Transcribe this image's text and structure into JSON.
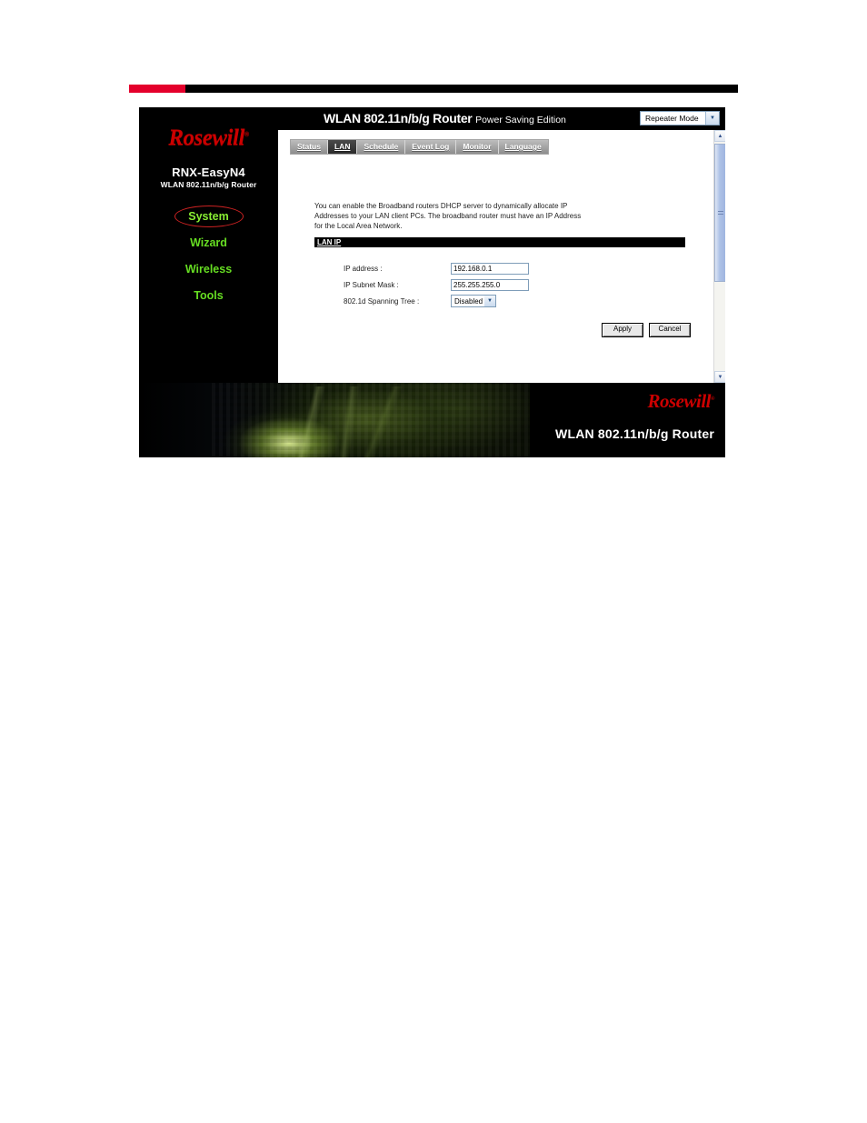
{
  "document": {
    "background": "#ffffff",
    "rule_colors": {
      "red": "#e4002b",
      "black": "#000000"
    }
  },
  "router_ui": {
    "sidebar": {
      "brand_logo": "Rosewill",
      "brand_reg_mark": "®",
      "model_name": "RNX-EasyN4",
      "model_subtitle": "WLAN 802.11n/b/g Router",
      "nav_items": [
        {
          "label": "System",
          "active": true
        },
        {
          "label": "Wizard",
          "active": false
        },
        {
          "label": "Wireless",
          "active": false
        },
        {
          "label": "Tools",
          "active": false
        }
      ],
      "active_color": "#88ee33",
      "nav_color": "#66dd22",
      "highlight_ring_color": "#cc2222"
    },
    "banner": {
      "title_main": "WLAN 802.11n/b/g Router",
      "title_sub": "Power Saving Edition",
      "mode_select": {
        "value": "Repeater Mode",
        "arrow_icon": "▼"
      }
    },
    "tabs": [
      {
        "label": "Status",
        "active": false
      },
      {
        "label": "LAN",
        "active": true
      },
      {
        "label": "Schedule",
        "active": false
      },
      {
        "label": "Event Log",
        "active": false
      },
      {
        "label": "Monitor",
        "active": false
      },
      {
        "label": "Language",
        "active": false
      }
    ],
    "content": {
      "description": "You can enable the Broadband routers DHCP server to dynamically allocate IP Addresses to your LAN client PCs. The broadband router must have an IP Address for the Local Area Network.",
      "section_title": "LAN IP",
      "fields": [
        {
          "label": "IP address :",
          "value": "192.168.0.1",
          "type": "text"
        },
        {
          "label": "IP Subnet Mask :",
          "value": "255.255.255.0",
          "type": "text"
        },
        {
          "label": "802.1d Spanning Tree :",
          "value": "Disabled",
          "type": "select",
          "arrow_icon": "▼"
        }
      ],
      "buttons": [
        {
          "label": "Apply"
        },
        {
          "label": "Cancel"
        }
      ]
    },
    "scrollbar": {
      "up_arrow": "▲",
      "down_arrow": "▼",
      "thumb_position_percent": 0
    },
    "footer": {
      "logo": "Rosewill",
      "logo_reg_mark": "®",
      "title": "WLAN 802.11n/b/g Router"
    }
  }
}
